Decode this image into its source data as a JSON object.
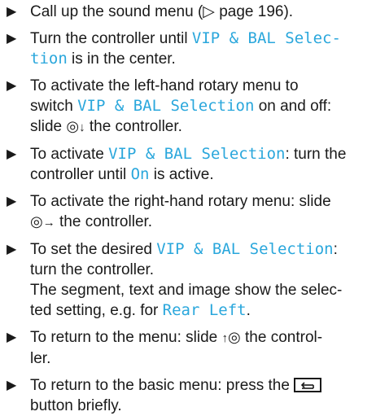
{
  "steps": [
    {
      "a": "Call up the sound menu (",
      "ref": "▷",
      "b": " page 196)."
    },
    {
      "a": "Turn the controller until ",
      "hl": "VIP & BAL Selec-",
      "hl2": "tion",
      "b": " is in the center."
    },
    {
      "a": "To activate the left-hand rotary menu to",
      "a2": "switch ",
      "hl": "VIP & BAL Selection",
      "b": " on and off:",
      "b2": "slide ",
      "arrow": "↓",
      "c": " the controller."
    },
    {
      "a": "To activate ",
      "hl": "VIP & BAL Selection",
      "b": ": turn the",
      "b2": "controller until ",
      "hl2": "On",
      "c": " is active."
    },
    {
      "a": "To activate the right-hand rotary menu: slide",
      "arrow": "→",
      "b": " the controller."
    },
    {
      "a": "To set the desired ",
      "hl": "VIP & BAL Selection",
      "b": ":",
      "b2": "turn the controller.",
      "c": "The segment, text and image show the selec-",
      "c2": "ted setting, e.g. for ",
      "hl2": "Rear Left",
      "d": "."
    },
    {
      "a": "To return to the menu: slide ",
      "arrow": "↑",
      "b": " the control-",
      "b2": "ler."
    },
    {
      "a": "To return to the basic menu: press the ",
      "b": "button briefly."
    }
  ],
  "icons": {
    "bullet": "triangle-bullet-icon",
    "controller": "controller-knob-icon",
    "back": "back-button-icon"
  },
  "colors": {
    "highlight": "#2aa7dc",
    "text": "#1a1a1a"
  }
}
